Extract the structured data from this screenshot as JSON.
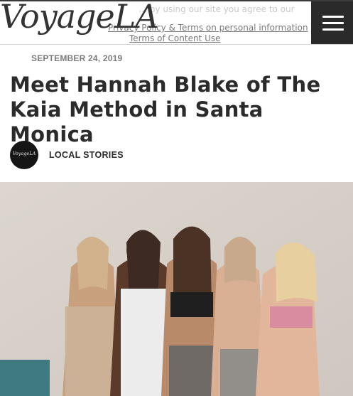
{
  "header": {
    "logo": {
      "voyage": "Voyage",
      "la": "LA"
    },
    "notice": {
      "line1": "… by using our site you agree to our",
      "line2": "Privacy Policy & Terms on personal information",
      "line3": "Terms of Content Use"
    },
    "menu_icon": "hamburger-menu-icon"
  },
  "article": {
    "date": "SEPTEMBER 24, 2019",
    "title": "Meet Hannah Blake of The Kaia Method in Santa Monica",
    "author_avatar_text": "VoyageLA",
    "category": "LOCAL STORIES"
  },
  "hero_image": {
    "alt": "Group of women in athletic wear"
  },
  "colors": {
    "header_border": "#d8d8d8",
    "menu_bg": "#2a2a2a",
    "title": "#2b2b2b",
    "date": "#7c7c7c"
  }
}
